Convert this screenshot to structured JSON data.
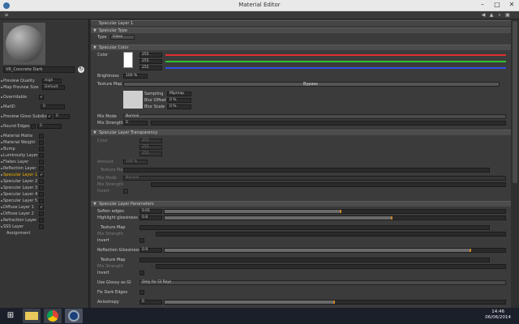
{
  "window": {
    "title": "Material Editor"
  },
  "left_panel": {
    "material_name": "VR_Concrete Dark",
    "rows": [
      {
        "label": "Preview Quality",
        "value": "High"
      },
      {
        "label": "Map Preview Size",
        "value": "Default"
      },
      {
        "label": "Overridable",
        "check": "✓"
      },
      {
        "label": "MatID",
        "value": "0"
      },
      {
        "label": "Preview Gloss Subdivs",
        "check": "✓",
        "value": "0"
      },
      {
        "label": "Round Edges",
        "value": "0"
      },
      {
        "label": "Material Matte"
      },
      {
        "label": "Material Weight"
      },
      {
        "label": "Bump"
      },
      {
        "label": "Luminosity Layer"
      },
      {
        "label": "Flakes Layer"
      },
      {
        "label": "Reflection Layer"
      },
      {
        "label": "Specular Layer 1",
        "check": "✓",
        "selected": true
      },
      {
        "label": "Specular Layer 2"
      },
      {
        "label": "Specular Layer 3"
      },
      {
        "label": "Specular Layer 4"
      },
      {
        "label": "Specular Layer 5"
      },
      {
        "label": "Diffuse Layer 1",
        "check": "✓"
      },
      {
        "label": "Diffuse Layer 2"
      },
      {
        "label": "Refraction Layer"
      },
      {
        "label": "SSS Layer"
      },
      {
        "label": "Assignment"
      }
    ]
  },
  "main": {
    "title": "Specular Layer 1",
    "sections": {
      "type": "Specular Type",
      "color": "Specular Color",
      "transparency": "Specular Layer Transparency",
      "parameters": "Specular Layer Parameters"
    },
    "type_label": "Type",
    "type_value": "Glass",
    "color_label": "Color",
    "rgb": [
      "255",
      "255",
      "255"
    ],
    "brightness_label": "Brightness",
    "brightness_value": "100 %",
    "texture_map_label": "Texture Map",
    "bypass_label": "Bypass",
    "sampling_label": "Sampling",
    "sampling_value": "Mipmap",
    "blur_offset_label": "Blur Offset",
    "blur_offset_value": "0 %",
    "blur_scale_label": "Blur Scale",
    "blur_scale_value": "0 %",
    "mix_mode_label": "Mix Mode",
    "mix_mode_value": "Normal",
    "mix_strength_label": "Mix Strength",
    "mix_strength_value": "0",
    "tr_color_label": "Color",
    "tr_rgb": [
      "255",
      "255",
      "255"
    ],
    "tr_amount_label": "Amount",
    "tr_amount_value": "100 %",
    "tr_texture_label": "Texture Map",
    "tr_mix_mode_label": "Mix Mode",
    "tr_mix_mode_value": "Normal",
    "tr_mix_strength_label": "Mix Strength",
    "tr_invert_label": "Invert",
    "soften_label": "Soften edges",
    "soften_value": "0.01",
    "soften_level": 0.52,
    "hl_gloss_label": "Highlight glossiness",
    "hl_gloss_value": "0.8",
    "hl_gloss_level": 0.67,
    "p_texture_label": "Texture Map",
    "p_mix_strength_label": "Mix Strength",
    "p_invert_label": "Invert",
    "refl_gloss_label": "Reflection Glossiness",
    "refl_gloss_value": "0.9",
    "refl_gloss_level": 0.9,
    "p2_texture_label": "Texture Map",
    "p2_mix_strength_label": "Mix Strength",
    "p2_invert_label": "Invert",
    "use_gi_label": "Use Glossy as GI",
    "use_gi_value": "Only for GI Rays",
    "fix_dark_label": "Fix Dark Edges",
    "anisotropy_label": "Anisotropy",
    "anisotropy_value": "0",
    "anisotropy_level": 0.5
  },
  "colors": {
    "red": "#e03030",
    "green": "#30c030",
    "blue": "#3050e0",
    "accent": "#c8842a"
  },
  "taskbar": {
    "time": "14:46",
    "date": "06/06/2014"
  }
}
